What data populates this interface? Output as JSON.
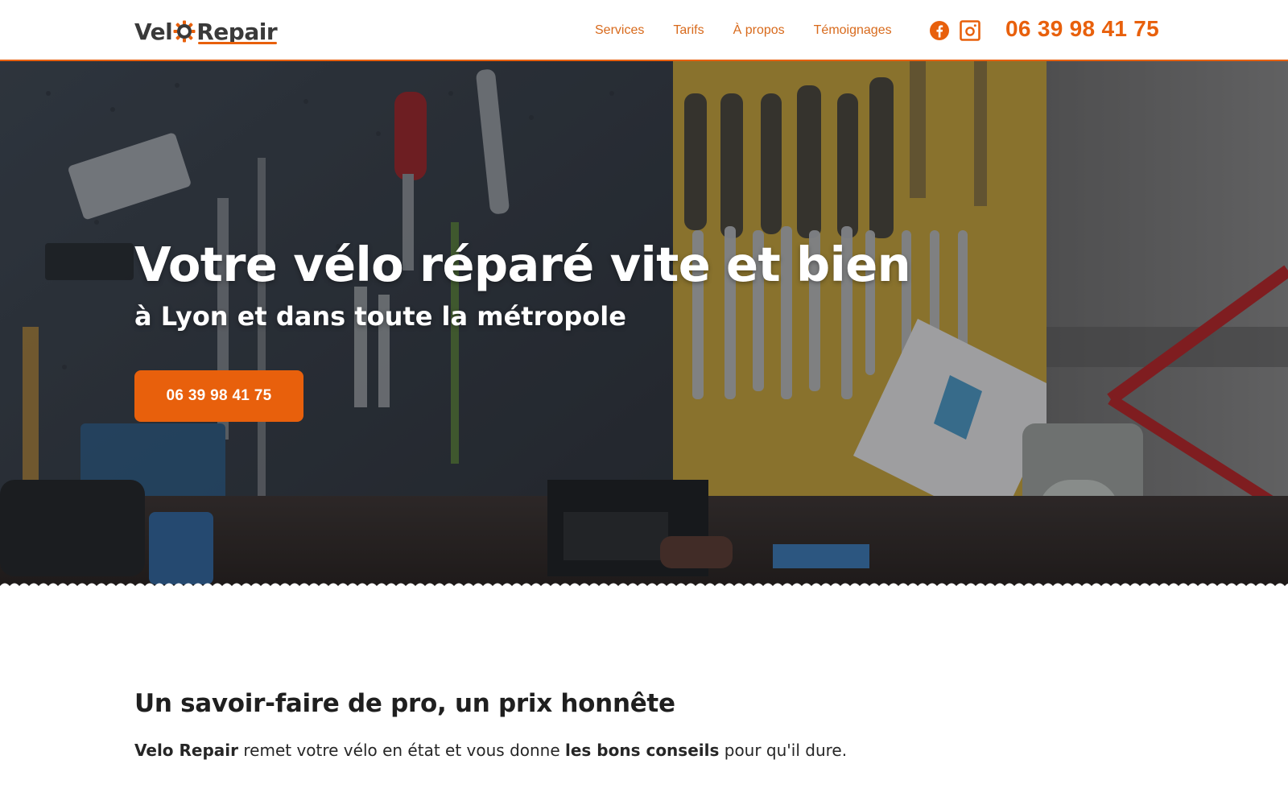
{
  "brand": {
    "logo_first": "Vel",
    "logo_second": "Repair",
    "accent_color": "#e8600c",
    "logo_gear_icon": "gear-icon"
  },
  "nav": {
    "items": [
      {
        "label": "Services"
      },
      {
        "label": "Tarifs"
      },
      {
        "label": "À propos"
      },
      {
        "label": "Témoignages"
      }
    ],
    "social": [
      {
        "icon": "facebook-icon"
      },
      {
        "icon": "instagram-icon"
      }
    ],
    "phone": "06 39 98 41 75"
  },
  "hero": {
    "title": "Votre vélo réparé vite et bien",
    "subtitle": "à Lyon et dans toute la métropole",
    "cta_label": "06 39 98 41 75",
    "background": "bike workshop tool wall"
  },
  "intro": {
    "heading": "Un savoir-faire de pro, un prix honnête",
    "text_bold_1": "Velo Repair",
    "text_1": " remet votre vélo en état et vous donne ",
    "text_bold_2": "les bons conseils",
    "text_2": " pour qu'il dure."
  }
}
